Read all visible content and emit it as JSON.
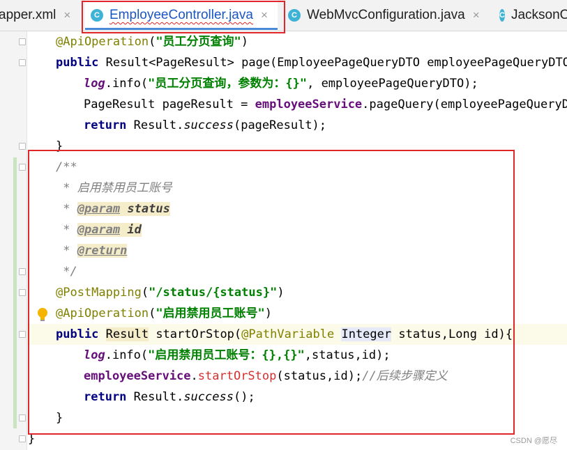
{
  "tabs": [
    {
      "label": "apper.xml",
      "close": "×"
    },
    {
      "label": "EmployeeController.java",
      "close": "×",
      "icon": "C",
      "active": true
    },
    {
      "label": "WebMvcConfiguration.java",
      "close": "×",
      "icon": "C"
    },
    {
      "label": "JacksonO",
      "icon": "C"
    }
  ],
  "code": {
    "l1": {
      "ann": "@ApiOperation",
      "open": "(",
      "str": "\"员工分页查询\"",
      "close": ")"
    },
    "l2": {
      "kw": "public",
      "rest": " Result<PageResult> page(EmployeePageQueryDTO employeePageQueryDTO)-"
    },
    "l3": {
      "log": "log",
      "mid": ".info(",
      "str": "\"员工分页查询，参数为：{}\"",
      "rest": ", employeePageQueryDTO);"
    },
    "l4": {
      "pre": "PageResult pageResult = ",
      "fld": "employeeService",
      "rest": ".pageQuery(employeePageQueryDTO"
    },
    "l5": {
      "kw": "return",
      "mid": " Result.",
      "it": "success",
      "rest": "(pageResult);"
    },
    "l6": {
      "text": "}"
    },
    "l7": {
      "text": "/**"
    },
    "l8": {
      "text": " * 启用禁用员工账号"
    },
    "l9": {
      "star": " * ",
      "tag": "@param",
      "sp": " ",
      "name": "status"
    },
    "l10": {
      "star": " * ",
      "tag": "@param",
      "sp": " ",
      "name": "id"
    },
    "l11": {
      "star": " * ",
      "tag": "@return"
    },
    "l12": {
      "text": " */"
    },
    "l13": {
      "ann": "@PostMapping",
      "open": "(",
      "str": "\"/status/{status}\"",
      "close": ")"
    },
    "l14": {
      "ann": "@ApiOperation",
      "open": "(",
      "str": "\"启用禁用员工账号\"",
      "close": ")"
    },
    "l15": {
      "kw": "public",
      "sp": " ",
      "type": "Result",
      "mid": " startOrStop(",
      "ann": "@PathVariable",
      "sp2": " ",
      "int": "Integer",
      "rest": " status,Long id){"
    },
    "l16": {
      "log": "log",
      "mid": ".info(",
      "str": "\"启用禁用员工账号：{},{}\"",
      "rest": ",status,id);"
    },
    "l17": {
      "fld": "employeeService",
      "dot": ".",
      "mth": "startOrStop",
      "rest": "(status,id);",
      "cmt": "//后续步骤定义"
    },
    "l18": {
      "kw": "return",
      "mid": " Result.",
      "it": "success",
      "rest": "();"
    },
    "l19": {
      "text": "}"
    },
    "l20": {
      "text": "}"
    }
  },
  "watermark": "CSDN @愿尽"
}
